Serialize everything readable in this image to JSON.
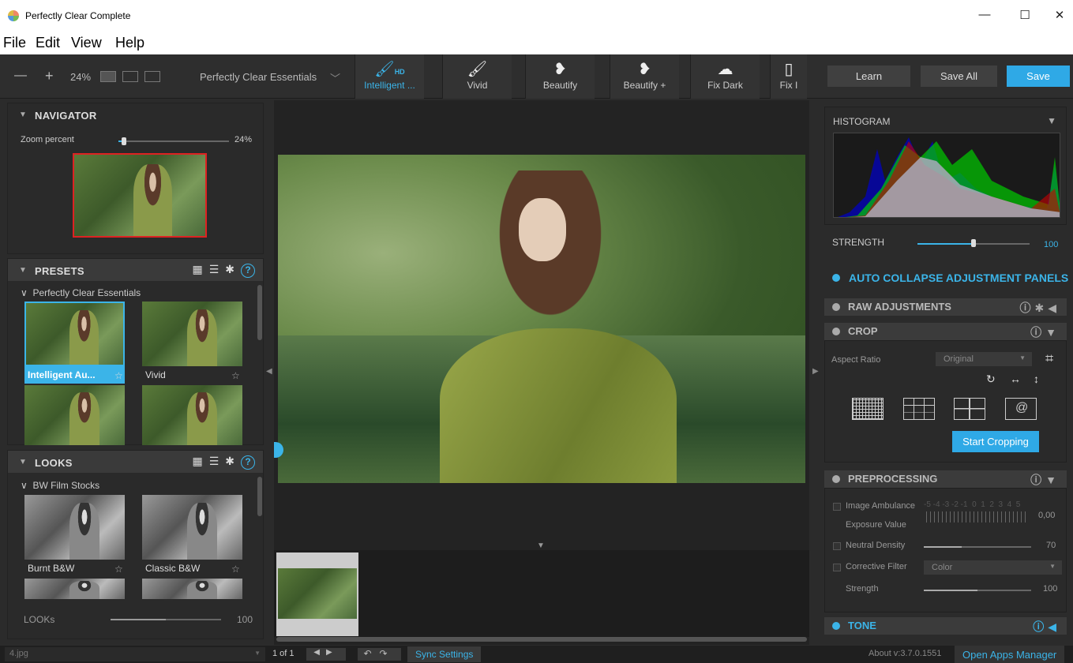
{
  "window": {
    "title": "Perfectly Clear Complete",
    "minimize": "—",
    "maximize": "☐",
    "close": "✕"
  },
  "menu": [
    "File",
    "Edit",
    "View",
    "Help"
  ],
  "toolbar": {
    "zoom_out": "—",
    "zoom_in": "+",
    "zoom_level": "24%",
    "preset_group": "Perfectly Clear Essentials",
    "preset_group_chevron": "﹀",
    "presets": [
      {
        "label": "Intelligent ...",
        "icon": "brush-hd-icon",
        "glyph": "🖌",
        "badge": "HD",
        "active": true
      },
      {
        "label": "Vivid",
        "icon": "brush-icon",
        "glyph": "🖌",
        "active": false
      },
      {
        "label": "Beautify",
        "icon": "beautify-icon",
        "glyph": "❥",
        "active": false
      },
      {
        "label": "Beautify +",
        "icon": "beautify-plus-icon",
        "glyph": "❥",
        "active": false
      },
      {
        "label": "Fix Dark",
        "icon": "fix-dark-icon",
        "glyph": "☁",
        "active": false
      },
      {
        "label": "Fix I",
        "icon": "fix-icon",
        "glyph": "▯",
        "active": false
      }
    ],
    "learn": "Learn",
    "save_all": "Save All",
    "save": "Save"
  },
  "navigator": {
    "title": "NAVIGATOR",
    "zoom_label": "Zoom percent",
    "zoom_value": "24%",
    "zoom_fraction": 0.05
  },
  "presets_panel": {
    "title": "PRESETS",
    "group": "Perfectly Clear Essentials",
    "items": [
      {
        "label": "Intelligent Au...",
        "active": true
      },
      {
        "label": "Vivid",
        "active": false
      }
    ]
  },
  "looks_panel": {
    "title": "LOOKS",
    "group": "BW Film Stocks",
    "items": [
      {
        "label": "Burnt B&W"
      },
      {
        "label": "Classic B&W"
      }
    ],
    "strength_label": "LOOKs",
    "strength_value": "100",
    "strength_fraction": 0.5
  },
  "right": {
    "histogram_title": "HISTOGRAM",
    "strength_label": "STRENGTH",
    "strength_value": "100",
    "strength_fraction": 0.5,
    "auto_collapse": "AUTO COLLAPSE ADJUSTMENT PANELS",
    "raw": "RAW ADJUSTMENTS",
    "crop": "CROP",
    "aspect_ratio_label": "Aspect Ratio",
    "aspect_ratio_value": "Original",
    "start_cropping": "Start Cropping",
    "preprocessing": "PREPROCESSING",
    "image_ambulance": "Image Ambulance",
    "exposure_value": "Exposure Value",
    "ev_scale": "-5 -4 -3 -2 -1  0  1  2  3  4  5",
    "ev_value": "0,00",
    "neutral_density": "Neutral Density",
    "nd_value": "70",
    "nd_fraction": 0.35,
    "corrective_filter": "Corrective Filter",
    "filter_value": "Color",
    "filter_strength_label": "Strength",
    "filter_strength_value": "100",
    "filter_strength_fraction": 0.5,
    "tone": "TONE"
  },
  "status": {
    "file": "4.jpg",
    "page": "1 of 1",
    "sync": "Sync Settings",
    "about": "About v:3.7.0.1551",
    "apps": "Open Apps Manager"
  },
  "colors": {
    "accent": "#3bb4e8",
    "bg": "#2b2b2b",
    "save": "#2fa9e6"
  }
}
